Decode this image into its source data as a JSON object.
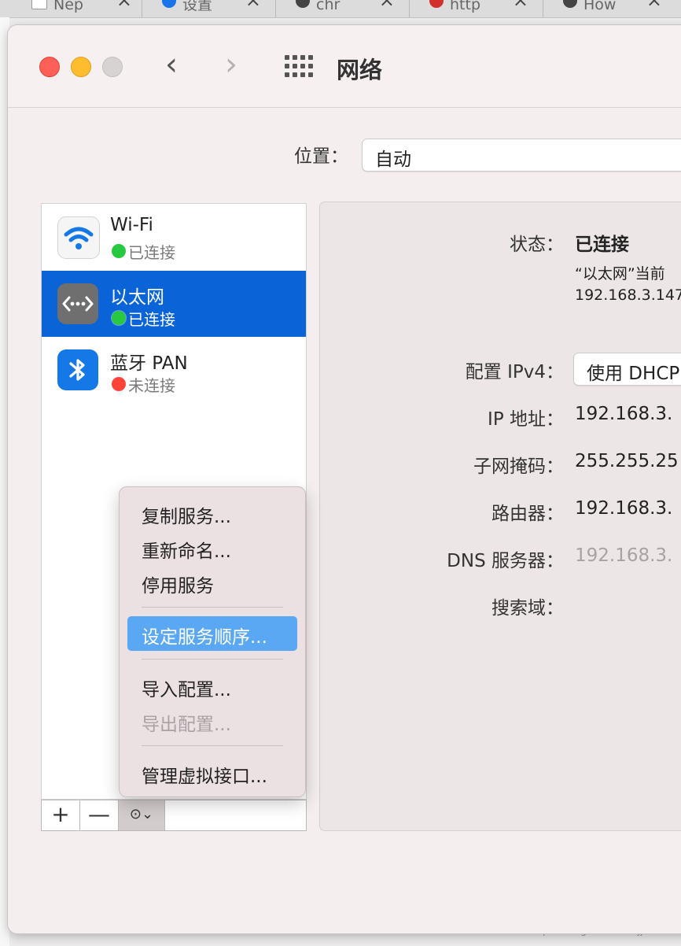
{
  "browser_tabs": [
    {
      "label": "Nep",
      "icon": "grid-doc-icon"
    },
    {
      "label": "设置",
      "icon": "gear-icon"
    },
    {
      "label": "chr",
      "icon": "globe-icon"
    },
    {
      "label": "http",
      "icon": "swirl-icon"
    },
    {
      "label": "How",
      "icon": "globe-icon"
    }
  ],
  "window": {
    "title": "网络"
  },
  "location": {
    "label": "位置：",
    "value": "自动"
  },
  "services": [
    {
      "name": "Wi-Fi",
      "status": "已连接",
      "status_color": "#28c840",
      "icon": "wifi-icon",
      "selected": false
    },
    {
      "name": "以太网",
      "status": "已连接",
      "status_color": "#28c840",
      "icon": "ethernet-icon",
      "selected": true
    },
    {
      "name": "蓝牙 PAN",
      "status": "未连接",
      "status_color": "#ff453a",
      "icon": "bluetooth-icon",
      "selected": false
    }
  ],
  "service_bar": {
    "add": "+",
    "remove": "—",
    "action": "⊙⌄"
  },
  "details": {
    "status_label": "状态：",
    "status_value": "已连接",
    "status_note_1": "“以太网”当前",
    "status_note_2": "192.168.3.147",
    "configure_label": "配置 IPv4：",
    "configure_value": "使用 DHCP",
    "ip_label": "IP 地址：",
    "ip_value": "192.168.3.",
    "subnet_label": "子网掩码：",
    "subnet_value": "255.255.25",
    "router_label": "路由器：",
    "router_value": "192.168.3.",
    "dns_label": "DNS 服务器：",
    "dns_value": "192.168.3.",
    "search_label": "搜索域："
  },
  "menu": {
    "items": [
      "复制服务...",
      "重新命名...",
      "停用服务",
      "设定服务顺序...",
      "导入配置...",
      "导出配置...",
      "管理虚拟接口..."
    ],
    "highlighted": "设定服务顺序...",
    "disabled": "导出配置..."
  },
  "watermark": "https://blog.csdn.net/jjt1997"
}
